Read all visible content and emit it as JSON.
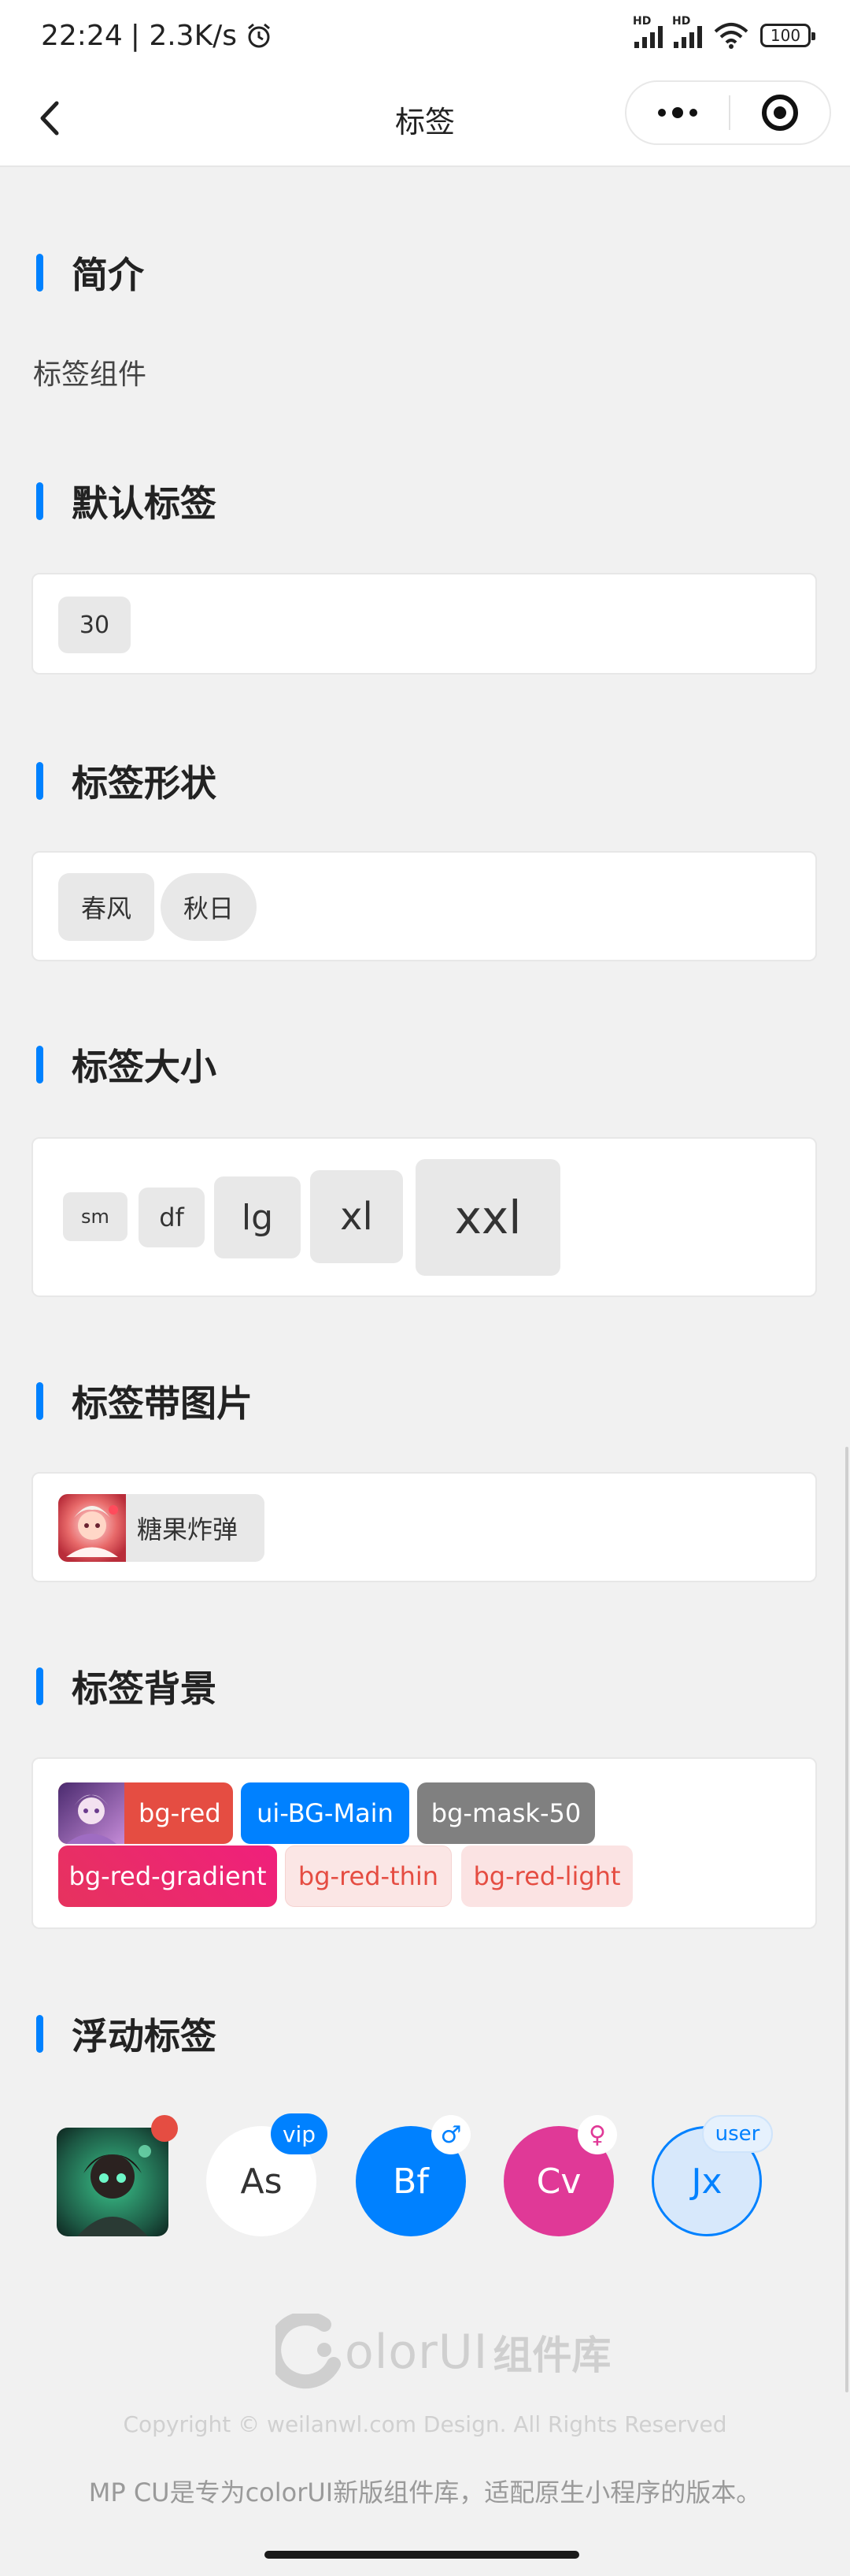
{
  "status_bar": {
    "time": "22:24",
    "speed": "| 2.3K/s",
    "battery": "100",
    "hd1": "HD",
    "hd2": "HD"
  },
  "nav": {
    "title": "标签"
  },
  "sections": {
    "intro_title": "简介",
    "intro_text": "标签组件",
    "default_title": "默认标签",
    "shape_title": "标签形状",
    "size_title": "标签大小",
    "image_title": "标签带图片",
    "bg_title": "标签背景",
    "float_title": "浮动标签"
  },
  "default_tag": "30",
  "shape_tags": [
    "春风",
    "秋日"
  ],
  "size_tags": [
    "sm",
    "df",
    "lg",
    "xl",
    "xxl"
  ],
  "image_tag": "糖果炸弹",
  "bg_tags": [
    "bg-red",
    "ui-BG-Main",
    "bg-mask-50",
    "bg-red-gradient",
    "bg-red-thin",
    "bg-red-light"
  ],
  "float_avatars": {
    "as": "As",
    "as_badge": "vip",
    "bf": "Bf",
    "bf_badge": "♂",
    "cv": "Cv",
    "cv_badge": "♀",
    "jx": "Jx",
    "jx_badge": "user"
  },
  "colors": {
    "accent": "#0081ff",
    "red": "#e54d42",
    "pink": "#e03997",
    "mask": "#808080"
  },
  "footer": {
    "logo_text": "olorUI",
    "logo_cn": "组件库",
    "copyright": "Copyright © weilanwl.com Design. All Rights Reserved",
    "note": "MP CU是专为colorUI新版组件库，适配原生小程序的版本。"
  }
}
